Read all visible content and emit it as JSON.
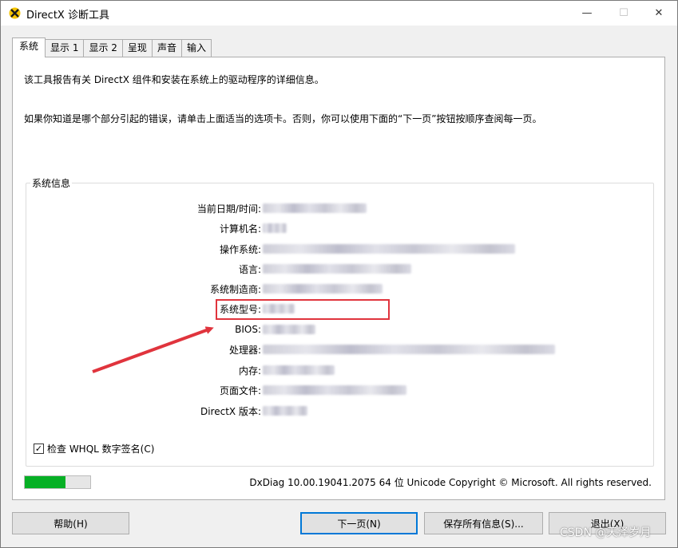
{
  "window": {
    "title": "DirectX 诊断工具",
    "minimize_glyph": "—",
    "maximize_glyph": "☐",
    "close_glyph": "✕"
  },
  "tabs": [
    {
      "label": "系统",
      "active": true
    },
    {
      "label": "显示 1",
      "active": false
    },
    {
      "label": "显示 2",
      "active": false
    },
    {
      "label": "呈现",
      "active": false
    },
    {
      "label": "声音",
      "active": false
    },
    {
      "label": "输入",
      "active": false
    }
  ],
  "intro": {
    "line1": "该工具报告有关 DirectX 组件和安装在系统上的驱动程序的详细信息。",
    "line2": "如果你知道是哪个部分引起的错误，请单击上面适当的选项卡。否则，你可以使用下面的“下一页”按钮按顺序查阅每一页。"
  },
  "system_info": {
    "group_label": "系统信息",
    "rows": [
      {
        "label": "当前日期/时间:"
      },
      {
        "label": "计算机名:"
      },
      {
        "label": "操作系统:"
      },
      {
        "label": "语言:"
      },
      {
        "label": "系统制造商:"
      },
      {
        "label": "系统型号:"
      },
      {
        "label": "BIOS:"
      },
      {
        "label": "处理器:"
      },
      {
        "label": "内存:"
      },
      {
        "label": "页面文件:"
      },
      {
        "label": "DirectX 版本:"
      }
    ]
  },
  "whql": {
    "label": "检查 WHQL 数字签名(C)",
    "checked": true,
    "check_glyph": "✓"
  },
  "progress": {
    "fraction": 0.62,
    "color": "#06b025"
  },
  "footer": {
    "version_text": "DxDiag 10.00.19041.2075 64 位 Unicode  Copyright © Microsoft. All rights reserved."
  },
  "buttons": {
    "help": "帮助(H)",
    "next": "下一页(N)",
    "save_all": "保存所有信息(S)...",
    "exit": "退出(X)"
  },
  "annotation": {
    "color": "#e0343d"
  },
  "watermark": "CSDN @天泽岁月"
}
